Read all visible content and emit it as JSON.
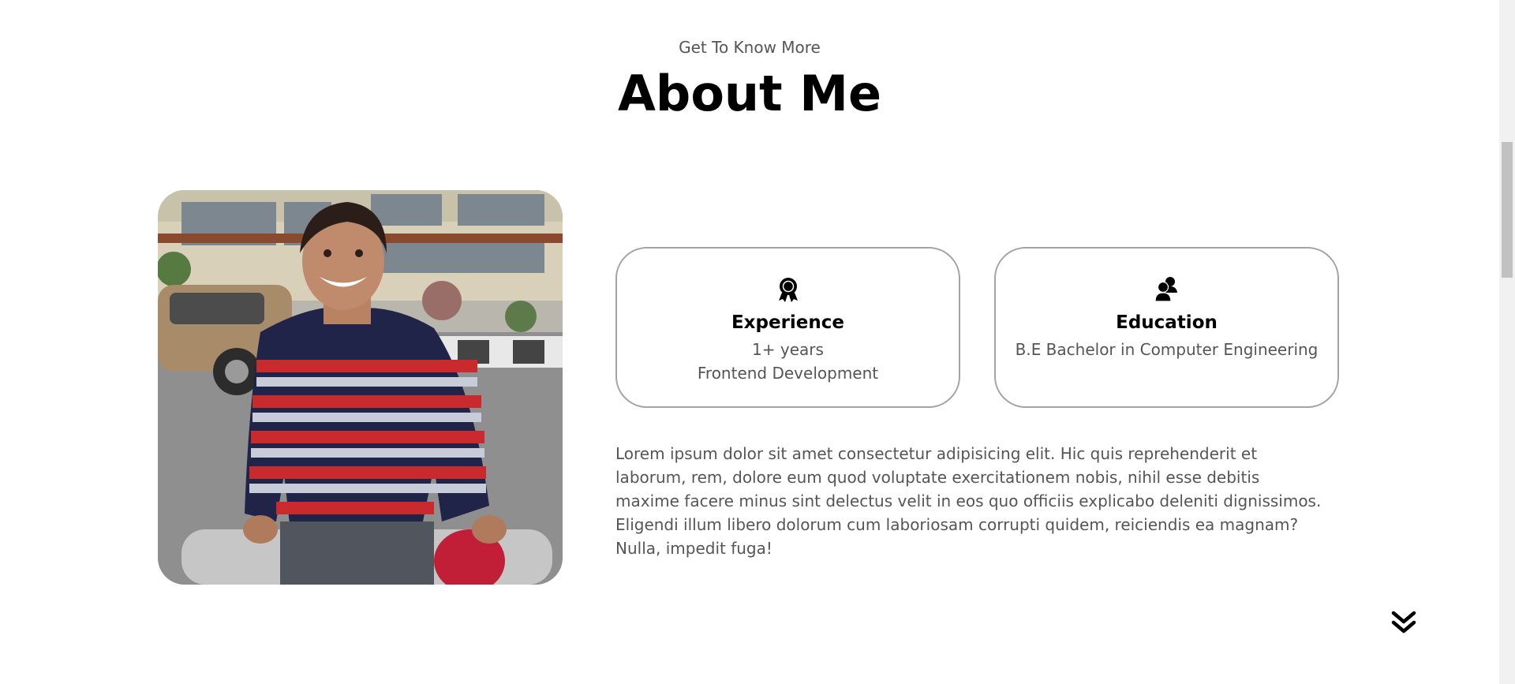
{
  "section": {
    "subtitle": "Get To Know More",
    "title": "About Me"
  },
  "profile_photo": {
    "alt": "Profile picture"
  },
  "cards": [
    {
      "icon": "award-icon",
      "title": "Experience",
      "line1": "1+ years",
      "line2": "Frontend Development"
    },
    {
      "icon": "users-icon",
      "title": "Education",
      "line1": "B.E Bachelor in Computer Engineering",
      "line2": ""
    }
  ],
  "about_text": "Lorem ipsum dolor sit amet consectetur adipisicing elit. Hic quis reprehenderit et laborum, rem, dolore eum quod voluptate exercitationem nobis, nihil esse debitis maxime facere minus sint delectus velit in eos quo officiis explicabo deleniti dignissimos. Eligendi illum libero dolorum cum laboriosam corrupti quidem, reiciendis ea magnam? Nulla, impedit fuga!",
  "scroll_arrow": {
    "icon": "double-chevron-down-icon"
  },
  "colors": {
    "heading": "#000000",
    "text": "#555555",
    "card_border": "#a3a3a3",
    "background": "#ffffff"
  }
}
